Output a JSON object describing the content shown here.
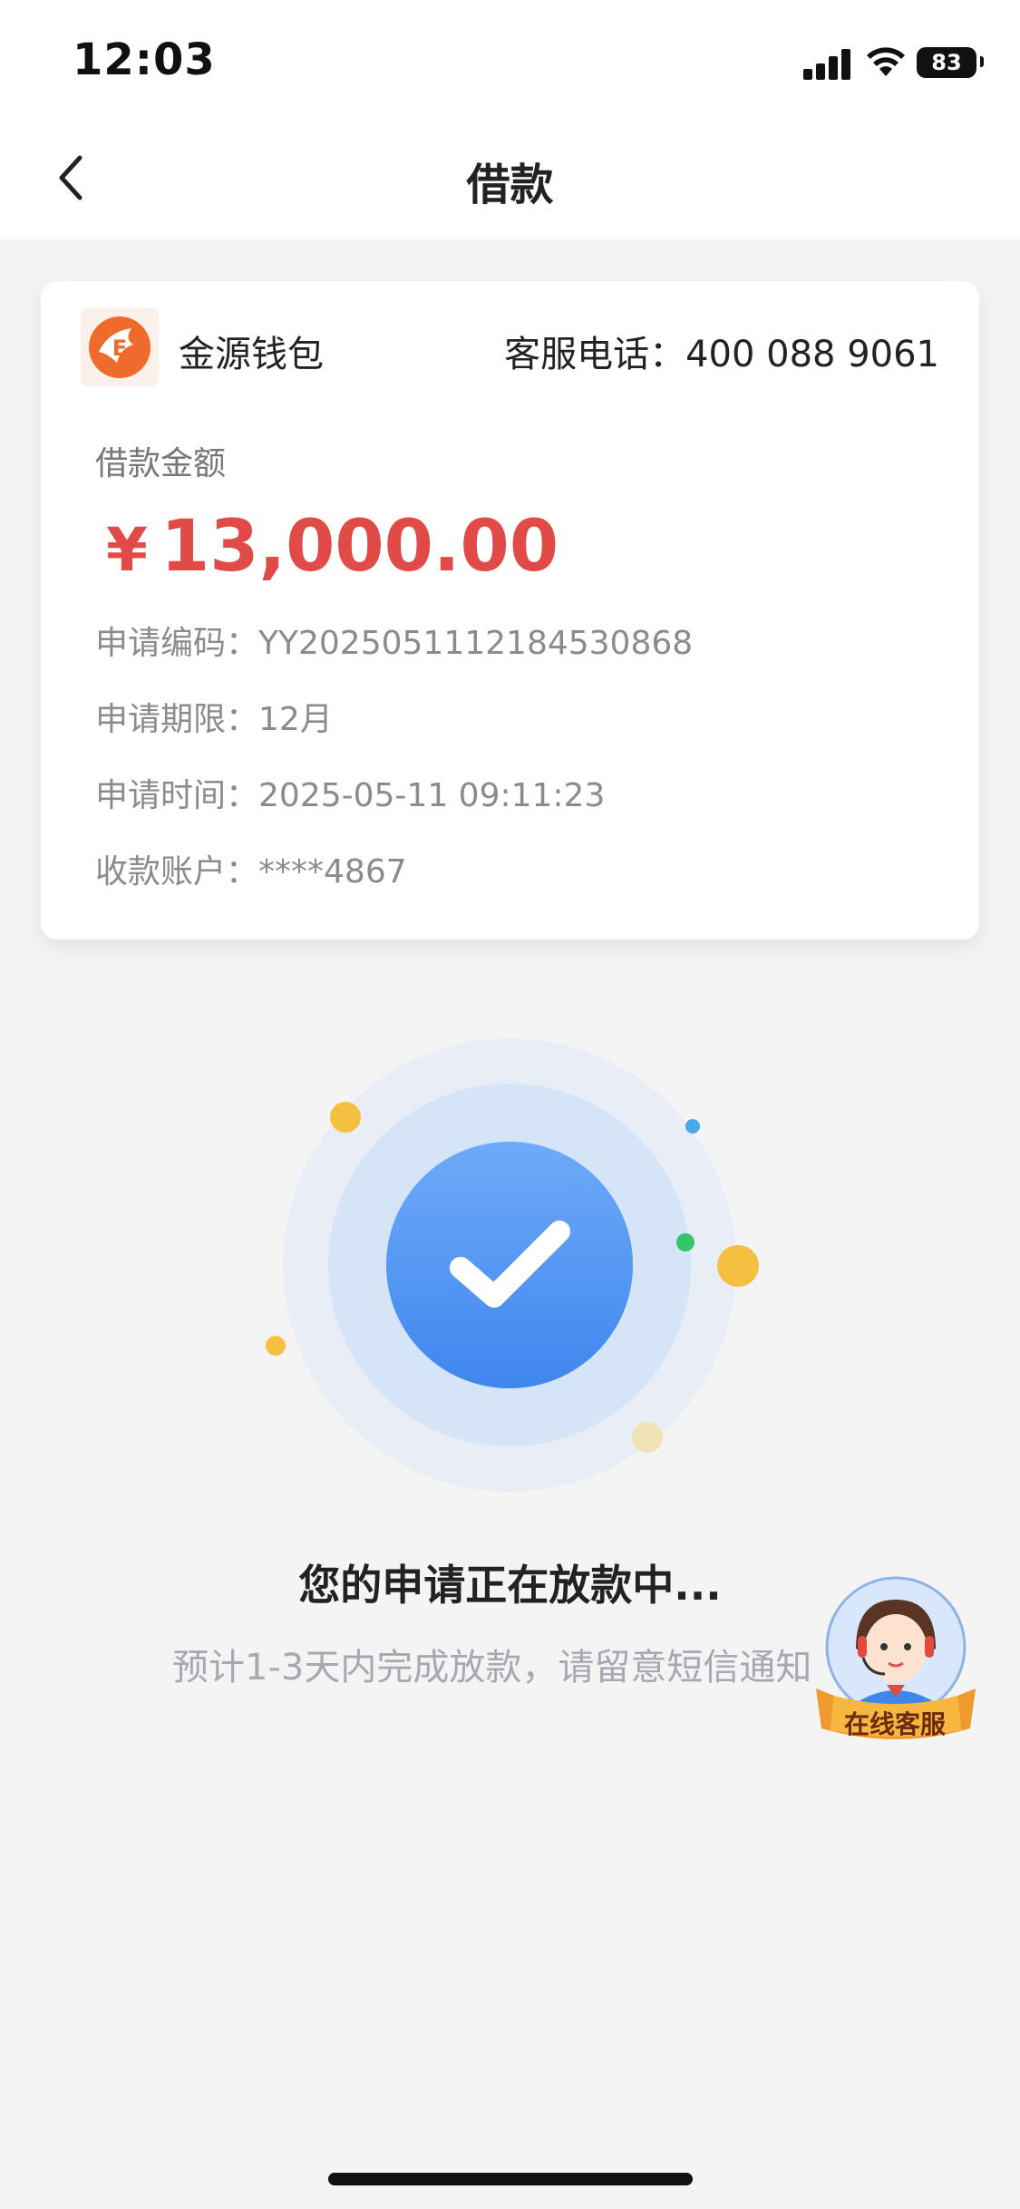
{
  "status_bar": {
    "time": "12:03",
    "battery": "83"
  },
  "nav": {
    "title": "借款"
  },
  "card": {
    "brand_name": "金源钱包",
    "hotline": "客服电话：400 088 9061",
    "amount_label": "借款金额",
    "amount_currency": "¥",
    "amount_value": "13,000.00",
    "rows": [
      {
        "label": "申请编码：",
        "value": "YY2025051112184530868"
      },
      {
        "label": "申请期限：",
        "value": "12月"
      },
      {
        "label": "申请时间：",
        "value": "2025-05-11 09:11:23"
      },
      {
        "label": "收款账户：",
        "value": "****4867"
      }
    ]
  },
  "status": {
    "title": "您的申请正在放款中...",
    "subtitle": "预计1-3天内完成放款，请留意短信通知"
  },
  "cs_widget": {
    "label": "在线客服"
  },
  "colors": {
    "accent_blue": "#4a8ef0",
    "amount_red": "#e14b47",
    "brand_orange": "#ef6b2c"
  },
  "icons": [
    "back-chevron-icon",
    "check-icon",
    "signal-icon",
    "wifi-icon",
    "battery-icon",
    "customer-service-avatar-icon"
  ]
}
